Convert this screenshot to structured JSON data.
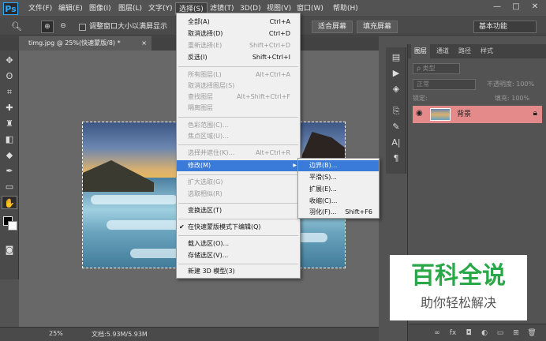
{
  "app": {
    "logo": "Ps"
  },
  "menubar": {
    "items": [
      "文件(F)",
      "编辑(E)",
      "图像(I)",
      "图层(L)",
      "文字(Y)",
      "选择(S)",
      "滤镜(T)",
      "3D(D)",
      "视图(V)",
      "窗口(W)",
      "帮助(H)"
    ],
    "window_buttons": {
      "minimize": "—",
      "restore": "□",
      "close": "✕"
    }
  },
  "options_bar": {
    "checkbox_label": "调整窗口大小以满屏显示",
    "fit_screen": "适合屏幕",
    "fill_screen": "填充屏幕",
    "workspace": "基本功能"
  },
  "document": {
    "tab_title": "timg.jpg @ 25%(快速蒙版/8) *",
    "tab_close": "×",
    "zoom": "25%",
    "doc_info": "文档:5.93M/5.93M"
  },
  "select_menu": {
    "items": [
      {
        "label": "全部(A)",
        "shortcut": "Ctrl+A",
        "enabled": true
      },
      {
        "label": "取消选择(D)",
        "shortcut": "Ctrl+D",
        "enabled": true
      },
      {
        "label": "重新选择(E)",
        "shortcut": "Shift+Ctrl+D",
        "enabled": false
      },
      {
        "label": "反选(I)",
        "shortcut": "Shift+Ctrl+I",
        "enabled": true
      },
      {
        "label": "所有图层(L)",
        "shortcut": "Alt+Ctrl+A",
        "enabled": false
      },
      {
        "label": "取消选择图层(S)",
        "shortcut": "",
        "enabled": false
      },
      {
        "label": "查找图层",
        "shortcut": "Alt+Shift+Ctrl+F",
        "enabled": false
      },
      {
        "label": "隔离图层",
        "shortcut": "",
        "enabled": false
      },
      {
        "label": "色彩范围(C)...",
        "shortcut": "",
        "enabled": false
      },
      {
        "label": "焦点区域(U)...",
        "shortcut": "",
        "enabled": false
      },
      {
        "label": "选择并遮住(K)...",
        "shortcut": "Alt+Ctrl+R",
        "enabled": false
      },
      {
        "label": "修改(M)",
        "shortcut": "",
        "enabled": true,
        "highlighted": true,
        "submenu": true
      },
      {
        "label": "扩大选取(G)",
        "shortcut": "",
        "enabled": false
      },
      {
        "label": "选取相似(R)",
        "shortcut": "",
        "enabled": false
      },
      {
        "label": "变换选区(T)",
        "shortcut": "",
        "enabled": true
      },
      {
        "label": "在快速蒙版模式下编辑(Q)",
        "shortcut": "",
        "enabled": true,
        "checked": true
      },
      {
        "label": "载入选区(O)...",
        "shortcut": "",
        "enabled": true
      },
      {
        "label": "存储选区(V)...",
        "shortcut": "",
        "enabled": true
      },
      {
        "label": "新建 3D 模型(3)",
        "shortcut": "",
        "enabled": true
      }
    ],
    "submenu_arrow": "▶",
    "check_mark": "✔"
  },
  "modify_submenu": {
    "items": [
      {
        "label": "边界(B)...",
        "shortcut": "",
        "highlighted": true
      },
      {
        "label": "平滑(S)...",
        "shortcut": ""
      },
      {
        "label": "扩展(E)...",
        "shortcut": ""
      },
      {
        "label": "收缩(C)...",
        "shortcut": ""
      },
      {
        "label": "羽化(F)...",
        "shortcut": "Shift+F6"
      }
    ]
  },
  "layers_panel": {
    "tabs": [
      "图层",
      "通道",
      "路径",
      "样式"
    ],
    "filter_kind": "ρ 类型",
    "blend_mode": "正常",
    "opacity_label": "不透明度: 100%",
    "lock_label": "锁定:",
    "fill_label": "填充: 100%",
    "layer_name": "背景"
  },
  "watermark": {
    "main": "百科全说",
    "sub": "助你轻松解决"
  }
}
